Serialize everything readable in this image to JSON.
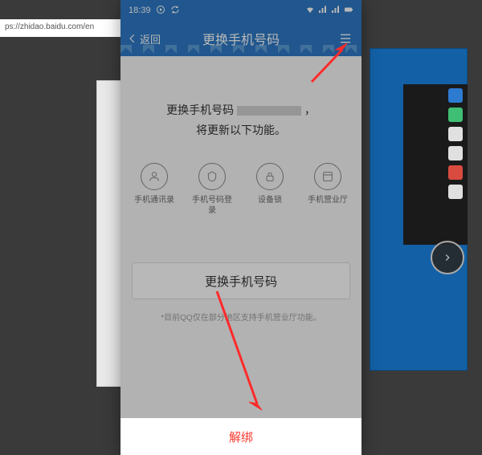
{
  "background": {
    "url_text": "ps://zhidao.baidu.com/en"
  },
  "statusbar": {
    "time": "18:39"
  },
  "header": {
    "back_label": "返回",
    "title": "更换手机号码"
  },
  "info": {
    "line1_prefix": "更换手机号码",
    "line1_suffix": "，",
    "line2": "将更新以下功能。"
  },
  "features": [
    {
      "label": "手机通讯录"
    },
    {
      "label": "手机号码登录"
    },
    {
      "label": "设备锁"
    },
    {
      "label": "手机营业厅"
    }
  ],
  "change_button": "更换手机号码",
  "note": "*目前QQ仅在部分地区支持手机营业厅功能。",
  "unbind": "解绑"
}
